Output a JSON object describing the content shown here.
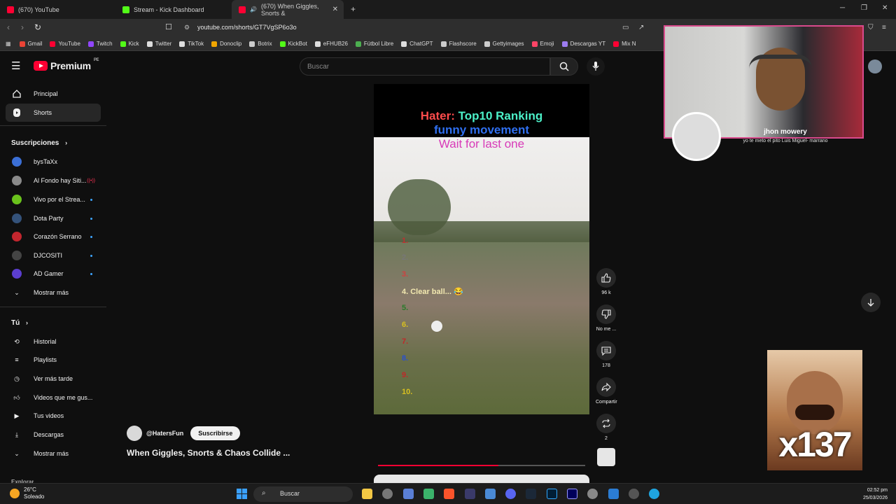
{
  "browser": {
    "tabs": [
      {
        "title": "(670) YouTube"
      },
      {
        "title": "Stream - Kick Dashboard"
      },
      {
        "title": "(670) When Giggles, Snorts &"
      }
    ],
    "url": "youtube.com/shorts/GT7VgSP6o3o",
    "bookmarks": [
      "Gmail",
      "YouTube",
      "Twitch",
      "Kick",
      "Twitter",
      "TikTok",
      "Donoclip",
      "Botrix",
      "KickBot",
      "eFHUB26",
      "Fútbol Libre",
      "ChatGPT",
      "Flashscore",
      "Gettyimages",
      "Emoji",
      "Descargas YT",
      "Mix N"
    ]
  },
  "header": {
    "logo": "Premium",
    "region": "PE",
    "search_placeholder": "Buscar"
  },
  "sidebar": {
    "main": [
      {
        "label": "Principal",
        "icon": "home-icon"
      },
      {
        "label": "Shorts",
        "icon": "shorts-icon"
      }
    ],
    "subs_header": "Suscripciones",
    "subs": [
      {
        "label": "bysTaXx",
        "color": "#3b6fd6"
      },
      {
        "label": "Al Fondo hay Siti...",
        "color": "#8a8a8a"
      },
      {
        "label": "Vivo por el Strea...",
        "color": "#6ac21c"
      },
      {
        "label": "Dota Party",
        "color": "#34527a"
      },
      {
        "label": "Corazón Serrano",
        "color": "#c2262e"
      },
      {
        "label": "DJCOSITI",
        "color": "#444"
      },
      {
        "label": "AD Gamer",
        "color": "#5b3ecf"
      }
    ],
    "subs_more": "Mostrar más",
    "you_header": "Tú",
    "you": [
      {
        "label": "Historial",
        "icon": "history-icon"
      },
      {
        "label": "Playlists",
        "icon": "playlist-icon"
      },
      {
        "label": "Ver más tarde",
        "icon": "clock-icon"
      },
      {
        "label": "Videos que me gus...",
        "icon": "like-icon"
      },
      {
        "label": "Tus videos",
        "icon": "video-icon"
      },
      {
        "label": "Descargas",
        "icon": "download-icon"
      }
    ],
    "you_more": "Mostrar más",
    "explore_cut": "Explorar"
  },
  "short": {
    "overlay_line1_a": "Hater:",
    "overlay_line1_b": "Top10 Ranking",
    "overlay_line2": "funny movement",
    "overlay_line3": "Wait for last one",
    "ranks": [
      "1.",
      "2.",
      "3.",
      "4. Clear ball... 😂",
      "5.",
      "6.",
      "7.",
      "8.",
      "9.",
      "10."
    ],
    "channel": "@HatersFun",
    "subscribe": "Suscribirse",
    "title": "When Giggles, Snorts & Chaos Collide ...",
    "progress": 0.58,
    "actions": {
      "likes": "96 k",
      "dislike": "No me ...",
      "comments": "178",
      "share": "Compartir",
      "remix": "2"
    }
  },
  "stream_overlay": {
    "alert_name": "jhon mowery",
    "alert_message": "yo te meto el pito Luis Miguel- marrano",
    "multiplier": "x137"
  },
  "taskbar": {
    "weather_temp": "26°C",
    "weather_desc": "Soleado",
    "search": "Buscar",
    "time": "02:52 pm",
    "date": "25/03/2026"
  }
}
